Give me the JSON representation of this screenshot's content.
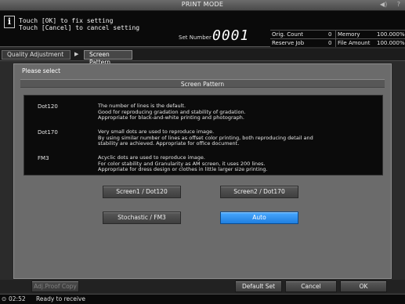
{
  "topbar": {
    "title": "PRINT MODE",
    "icons": [
      "speaker-icon",
      "help-icon"
    ]
  },
  "message": {
    "line1": "Touch [OK] to fix setting",
    "line2": "Touch [Cancel] to cancel setting",
    "set_number_label": "Set Number",
    "set_number_value": "0001"
  },
  "counters": {
    "orig_count_label": "Orig. Count",
    "orig_count_value": "0",
    "memory_label": "Memory",
    "memory_value": "100.000%",
    "reserve_job_label": "Reserve Job",
    "reserve_job_value": "0",
    "file_amount_label": "File Amount",
    "file_amount_value": "100.000%"
  },
  "breadcrumb": {
    "parent": "Quality Adjustment",
    "arrow": "▶",
    "current": "Screen Pattern"
  },
  "main": {
    "prompt": "Please select",
    "header": "Screen Pattern",
    "descriptions": [
      {
        "name": "Dot120",
        "lines": [
          "The number of lines is the default.",
          "Good for reproducing gradation and stability of gradation.",
          "Appropriate for black-and-white printing and photograph."
        ]
      },
      {
        "name": "Dot170",
        "lines": [
          "Very small dots are used to reproduce image.",
          "By using similar number of lines as offset color printing, both reproducing detail and",
          "stability are achieved. Appropriate for office document."
        ]
      },
      {
        "name": "FM3",
        "lines": [
          "Acyclic dots are used to reproduce image.",
          "For color stability and Granularity as AM screen, it uses 200 lines.",
          "Appropriate for dress design or clothes in little larger size printing."
        ]
      }
    ],
    "options": {
      "screen1": "Screen1 / Dot120",
      "screen2": "Screen2 / Dot170",
      "stochastic": "Stochastic / FM3",
      "auto": "Auto"
    },
    "selected": "Auto"
  },
  "bottom": {
    "adj_proof_copy": "Adj.Proof Copy",
    "default_set": "Default Set",
    "cancel": "Cancel",
    "ok": "OK"
  },
  "status": {
    "time": "02:52",
    "text": "Ready to receive"
  }
}
